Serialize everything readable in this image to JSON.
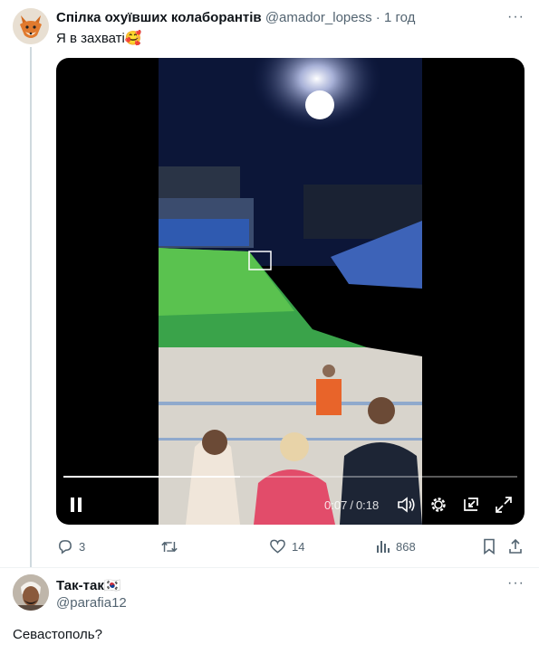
{
  "tweet": {
    "author_name": "Спілка охуївших колаборантів",
    "handle": "@amador_lopess",
    "separator": "·",
    "time": "1 год",
    "text": "Я в захваті🥰",
    "more_label": "···",
    "video": {
      "current_time": "0:07",
      "duration": "0:18",
      "time_separator": "/",
      "progress": 0.39
    },
    "actions": {
      "replies": "3",
      "reposts": "",
      "likes": "14",
      "views": "868"
    }
  },
  "reply": {
    "author_name": "Так-так🇰🇷",
    "handle": "@parafia12",
    "text": "Севастополь?",
    "more_label": "···"
  },
  "colors": {
    "muted": "#536471",
    "text": "#0f1419",
    "thread_line": "#cfd9de",
    "divider": "#eff3f4"
  },
  "icons": [
    "fox-avatar",
    "man-avatar",
    "pause-icon",
    "volume-icon",
    "gear-icon",
    "pip-icon",
    "fullscreen-icon",
    "reply-icon",
    "repost-icon",
    "like-icon",
    "views-icon",
    "bookmark-icon",
    "share-icon",
    "more-icon"
  ]
}
